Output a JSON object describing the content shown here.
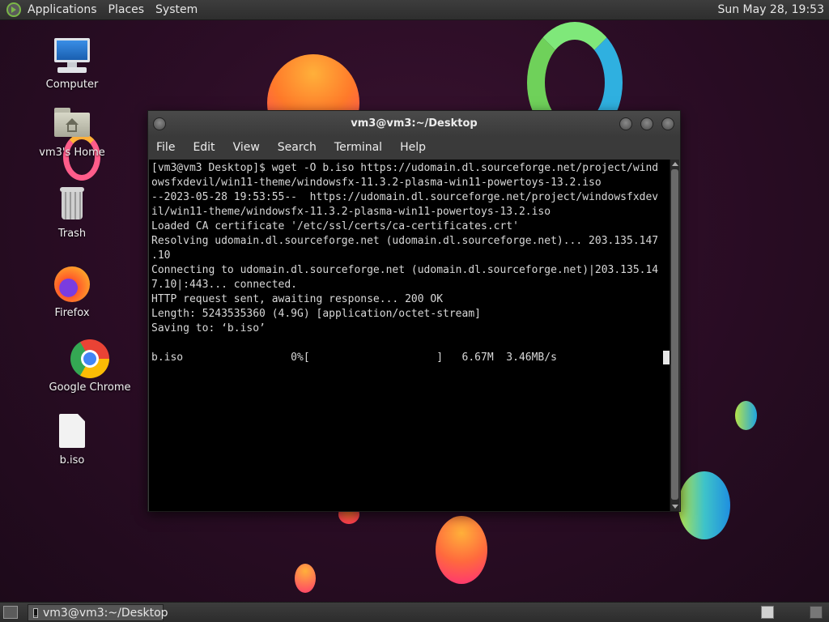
{
  "top_panel": {
    "menus": [
      "Applications",
      "Places",
      "System"
    ],
    "clock": "Sun May 28, 19:53"
  },
  "desktop_icons": [
    {
      "label": "Computer",
      "icon": "computer-icon"
    },
    {
      "label": "vm3's Home",
      "icon": "home-folder-icon"
    },
    {
      "label": "Trash",
      "icon": "trash-icon"
    },
    {
      "label": "Firefox",
      "icon": "firefox-icon"
    },
    {
      "label": "Google Chrome",
      "icon": "chrome-icon"
    },
    {
      "label": "b.iso",
      "icon": "file-icon"
    }
  ],
  "terminal": {
    "title": "vm3@vm3:~/Desktop",
    "menu": [
      "File",
      "Edit",
      "View",
      "Search",
      "Terminal",
      "Help"
    ],
    "lines": [
      "[vm3@vm3 Desktop]$ wget -O b.iso https://udomain.dl.sourceforge.net/project/wind",
      "owsfxdevil/win11-theme/windowsfx-11.3.2-plasma-win11-powertoys-13.2.iso",
      "--2023-05-28 19:53:55--  https://udomain.dl.sourceforge.net/project/windowsfxdev",
      "il/win11-theme/windowsfx-11.3.2-plasma-win11-powertoys-13.2.iso",
      "Loaded CA certificate '/etc/ssl/certs/ca-certificates.crt'",
      "Resolving udomain.dl.sourceforge.net (udomain.dl.sourceforge.net)... 203.135.147",
      ".10",
      "Connecting to udomain.dl.sourceforge.net (udomain.dl.sourceforge.net)|203.135.14",
      "7.10|:443... connected.",
      "HTTP request sent, awaiting response... 200 OK",
      "Length: 5243535360 (4.9G) [application/octet-stream]",
      "Saving to: ‘b.iso’",
      ""
    ],
    "progress_line": "b.iso                 0%[                    ]   6.67M  3.46MB/s",
    "progress_percent": 0
  },
  "taskbar": {
    "tasks": [
      {
        "label": "vm3@vm3:~/Desktop",
        "icon": "terminal-icon"
      }
    ]
  }
}
